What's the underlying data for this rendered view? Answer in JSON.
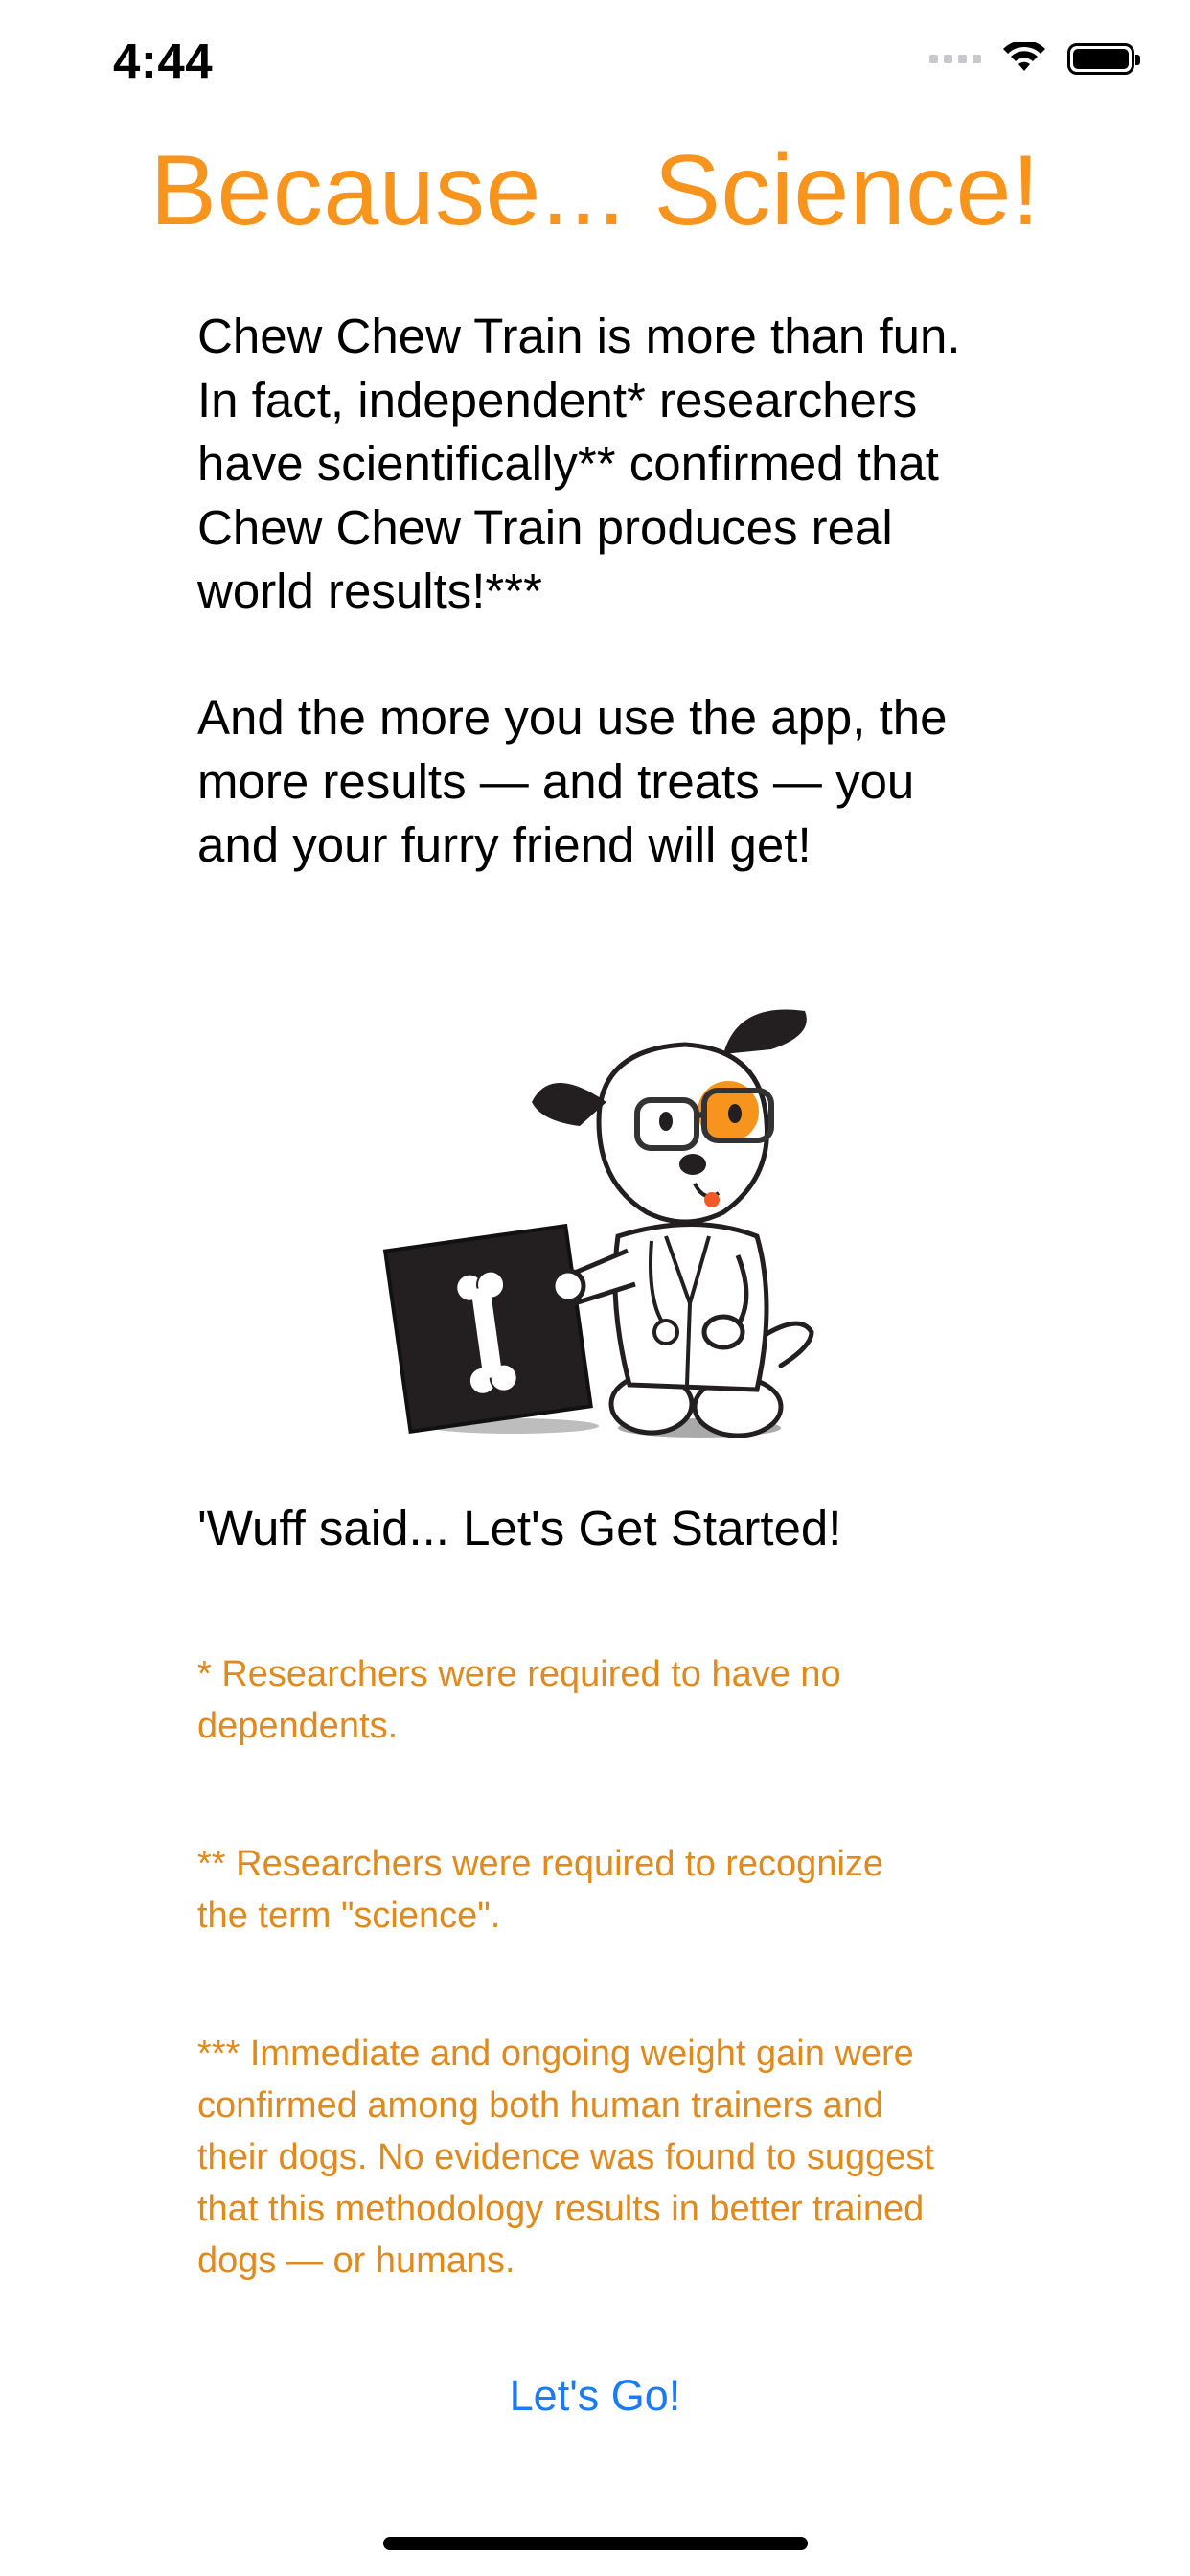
{
  "status_bar": {
    "time": "4:44"
  },
  "title": "Because... Science!",
  "paragraphs": [
    "Chew Chew Train is more than fun.\nIn fact, independent* researchers\nhave scientifically** confirmed that\nChew Chew Train produces real\nworld results!***",
    "And the more you use the app, the\nmore results — and treats — you\nand your furry friend will get!"
  ],
  "tagline": "'Wuff said... Let's Get Started!",
  "footnotes": [
    "* Researchers were required to have no\ndependents.",
    "** Researchers were required to recognize\nthe term \"science\".",
    "*** Immediate and ongoing weight gain were\nconfirmed among both human trainers and\ntheir dogs. No evidence was found to suggest\nthat this methodology results in better trained\ndogs — or humans."
  ],
  "action_button": "Let's Go!",
  "colors": {
    "title": "#f7941d",
    "footnote": "#e08a1e",
    "link": "#1a7cf5"
  },
  "illustration": {
    "icon": "scientist-dog-illustration"
  }
}
